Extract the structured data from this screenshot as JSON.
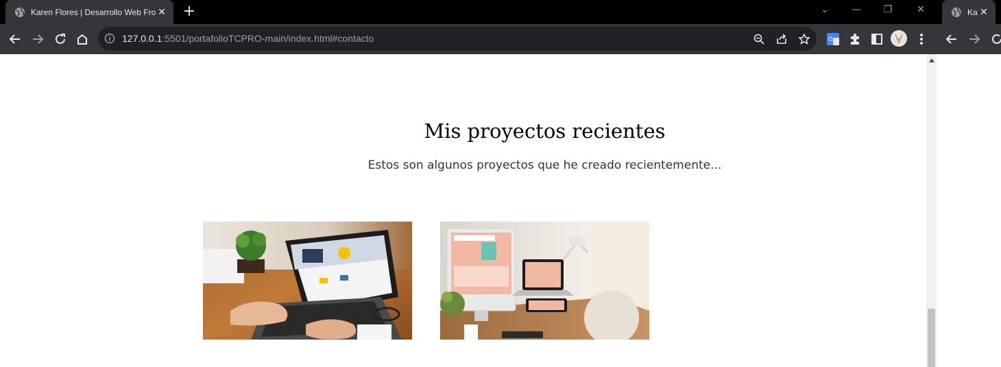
{
  "browser": {
    "tabs": [
      {
        "title": "Karen Flores | Desarrollo Web Front",
        "close": "✕"
      },
      {
        "title": "Kar",
        "close": "✕"
      }
    ],
    "new_tab": "+",
    "url_host": "127.0.0.1",
    "url_path": ":5501/portafolioTCPRO-main/index.html#contacto",
    "window_controls": {
      "minimize": "—",
      "restore": "❐",
      "close": "✕",
      "tab_search": "⌄"
    }
  },
  "page": {
    "heading": "Mis proyectos recientes",
    "subheading": "Estos son algunos proyectos que he creado recientemente...",
    "projects": [
      {
        "image_desc": "laptop-web-design-photo"
      },
      {
        "image_desc": "desktop-devices-web-design-photo"
      }
    ]
  },
  "colors": {
    "tab_bg": "#35363a",
    "omnibox_bg": "#202124",
    "chrome_text": "#e8eaed",
    "muted_text": "#9aa0a6"
  }
}
